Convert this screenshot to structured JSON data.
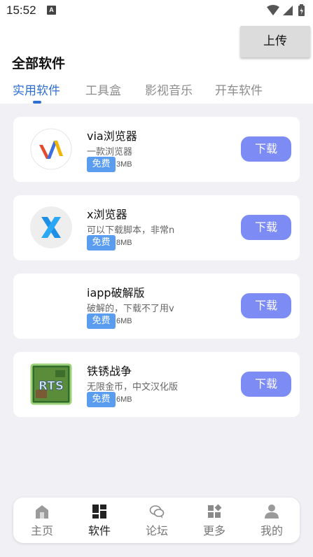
{
  "status_bar": {
    "time": "15:52",
    "notif_icon": "A"
  },
  "header": {
    "upload_label": "上传",
    "section_title": "全部软件"
  },
  "tabs": [
    {
      "label": "实用软件",
      "active": true
    },
    {
      "label": "工具盒",
      "active": false
    },
    {
      "label": "影视音乐",
      "active": false
    },
    {
      "label": "开车软件",
      "active": false
    }
  ],
  "apps": [
    {
      "name": "via浏览器",
      "desc": "一款浏览器",
      "badge": "免费",
      "size": "3MB",
      "button": "下载",
      "icon": "via-logo-icon"
    },
    {
      "name": "x浏览器",
      "desc": "可以下载脚本，非常n",
      "badge": "免费",
      "size": "8MB",
      "button": "下载",
      "icon": "x-browser-logo-icon"
    },
    {
      "name": "iapp破解版",
      "desc": "破解的，下载不了用v",
      "badge": "免费",
      "size": "6MB",
      "button": "下载",
      "icon": "blank-icon"
    },
    {
      "name": "铁锈战争",
      "desc": "无限金币，中文汉化版",
      "badge": "免费",
      "size": "6MB",
      "button": "下载",
      "icon": "rts-game-icon",
      "icon_text": "RTS"
    }
  ],
  "bottom_nav": [
    {
      "label": "主页",
      "icon": "home-icon",
      "active": false
    },
    {
      "label": "软件",
      "icon": "apps-grid-icon",
      "active": true
    },
    {
      "label": "论坛",
      "icon": "chat-icon",
      "active": false
    },
    {
      "label": "更多",
      "icon": "more-grid-icon",
      "active": false
    },
    {
      "label": "我的",
      "icon": "user-icon",
      "active": false
    }
  ],
  "colors": {
    "accent": "#2f6fd4",
    "download_button": "#7d8bf5",
    "badge": "#5a9cf0",
    "background": "#f1f0f5"
  }
}
